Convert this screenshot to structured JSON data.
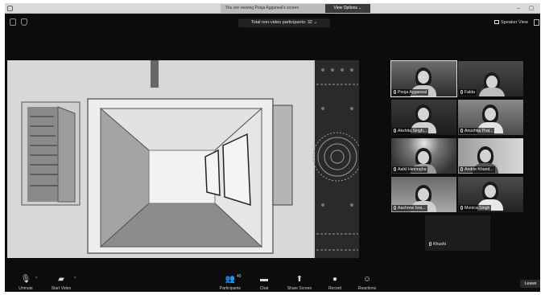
{
  "window": {
    "banner_text": "You are viewing Pooja Aggarwal's screen",
    "view_options_label": "View Options ⌄",
    "minimize_glyph": "–",
    "maximize_glyph": "▢"
  },
  "topbar": {
    "nonvideo_label": "Total non-video participants: 32 ⌄",
    "speaker_view_label": "Speaker View"
  },
  "participants": [
    {
      "name": "Pooja Aggarwal",
      "video": true,
      "active": true
    },
    {
      "name": "Falda",
      "video": true
    },
    {
      "name": "Akshita Singh...",
      "video": true
    },
    {
      "name": "Anushka Prat...",
      "video": true
    },
    {
      "name": "Aahil Hemrajha",
      "video": true
    },
    {
      "name": "Andrie Khand...",
      "video": true
    },
    {
      "name": "Aashrew Isra...",
      "video": true
    },
    {
      "name": "Monica Singh",
      "video": true
    },
    {
      "name": "Khushi",
      "video": false
    }
  ],
  "toolbar": {
    "unmute_label": "Unmute",
    "start_video_label": "Start Video",
    "participants_label": "Participants",
    "participants_count": "40",
    "chat_label": "Chat",
    "share_screen_label": "Share Screen",
    "record_label": "Record",
    "reactions_label": "Reactions",
    "leave_label": "Leave"
  }
}
